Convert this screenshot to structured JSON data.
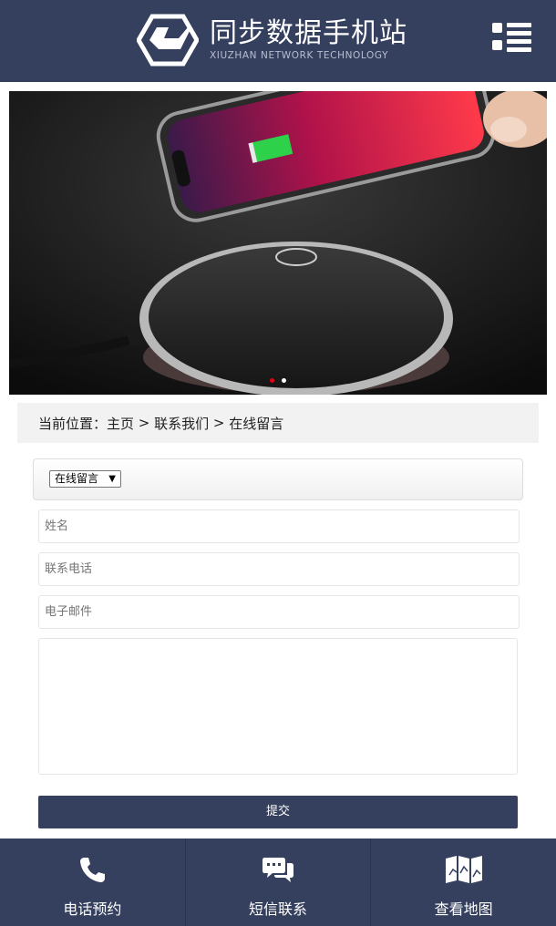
{
  "header": {
    "title": "同步数据手机站",
    "subtitle": "XIUZHAN NETWORK TECHNOLOGY",
    "logo_icon": "hexagon-logo",
    "menu_icon": "list-menu-icon"
  },
  "banner": {
    "image": "wireless-charger-with-phone",
    "slides": 2,
    "active_slide": 1
  },
  "breadcrumb": {
    "label": "当前位置：",
    "items": [
      "主页",
      "联系我们",
      "在线留言"
    ],
    "separator": " > "
  },
  "form": {
    "select_value": "在线留言",
    "name_placeholder": "姓名",
    "phone_placeholder": "联系电话",
    "email_placeholder": "电子邮件",
    "submit_label": "提交"
  },
  "footer": {
    "items": [
      {
        "label": "电话预约",
        "icon": "phone-icon"
      },
      {
        "label": "短信联系",
        "icon": "chat-bubbles-icon"
      },
      {
        "label": "查看地图",
        "icon": "folded-map-icon"
      }
    ]
  },
  "colors": {
    "primary": "#353f5e",
    "breadcrumb_bg": "#f2f2f2",
    "active_dot": "#e60012"
  }
}
